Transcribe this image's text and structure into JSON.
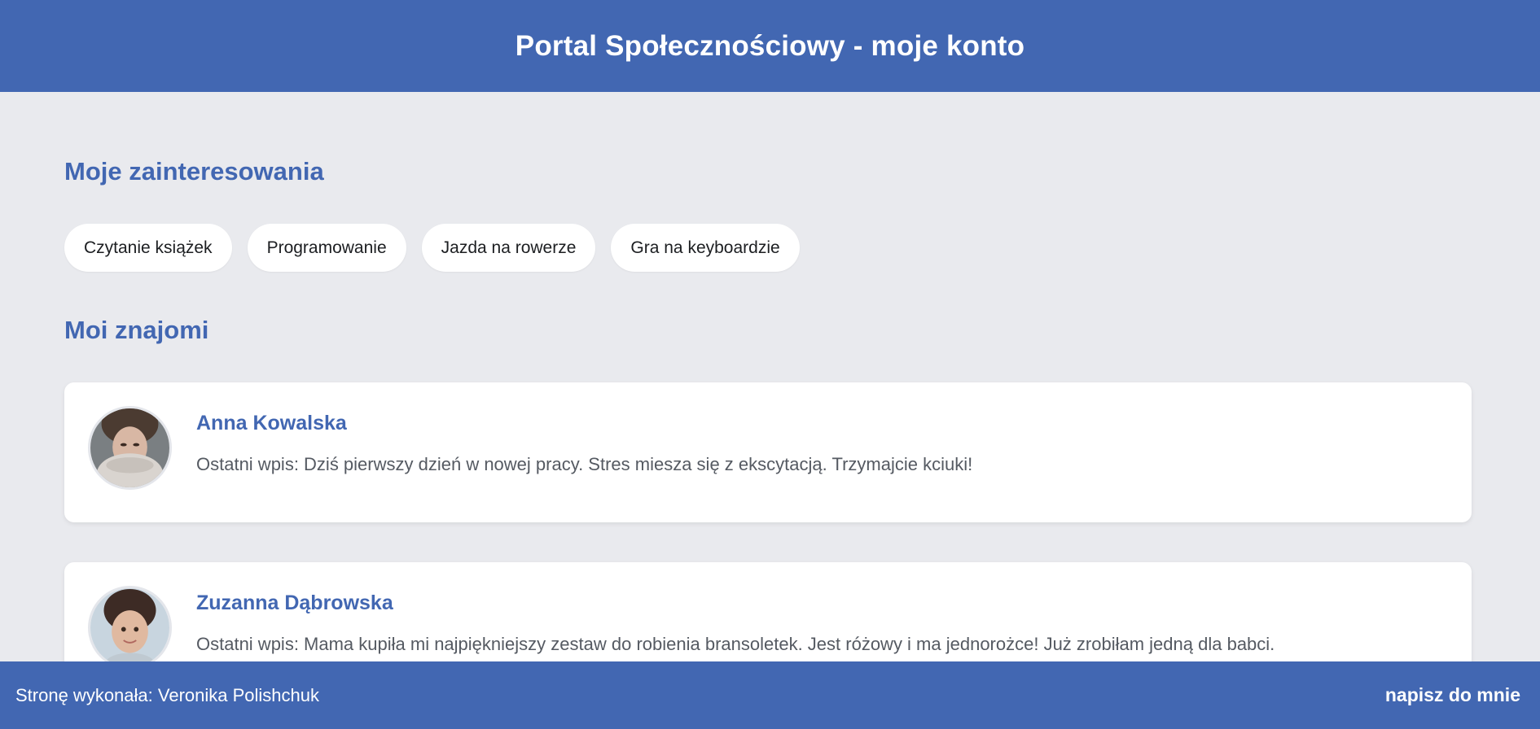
{
  "header": {
    "title": "Portal Społecznościowy - moje konto"
  },
  "interests": {
    "title": "Moje zainteresowania",
    "items": [
      {
        "label": "Czytanie książek"
      },
      {
        "label": "Programowanie"
      },
      {
        "label": "Jazda na rowerze"
      },
      {
        "label": "Gra na keyboardzie"
      }
    ]
  },
  "friends": {
    "title": "Moi znajomi",
    "items": [
      {
        "name": "Anna Kowalska",
        "post": "Ostatni wpis: Dziś pierwszy dzień w nowej pracy. Stres miesza się z ekscytacją. Trzymajcie kciuki!"
      },
      {
        "name": "Zuzanna Dąbrowska",
        "post": "Ostatni wpis: Mama kupiła mi najpiękniejszy zestaw do robienia bransoletek. Jest różowy i ma jednorożce! Już zrobiłam jedną dla babci."
      }
    ]
  },
  "footer": {
    "author": "Stronę wykonała: Veronika Polishchuk",
    "contact": "napisz do mnie"
  },
  "colors": {
    "brand": "#4267b2",
    "background": "#e9eaee",
    "card": "#ffffff",
    "text_muted": "#555a62"
  }
}
